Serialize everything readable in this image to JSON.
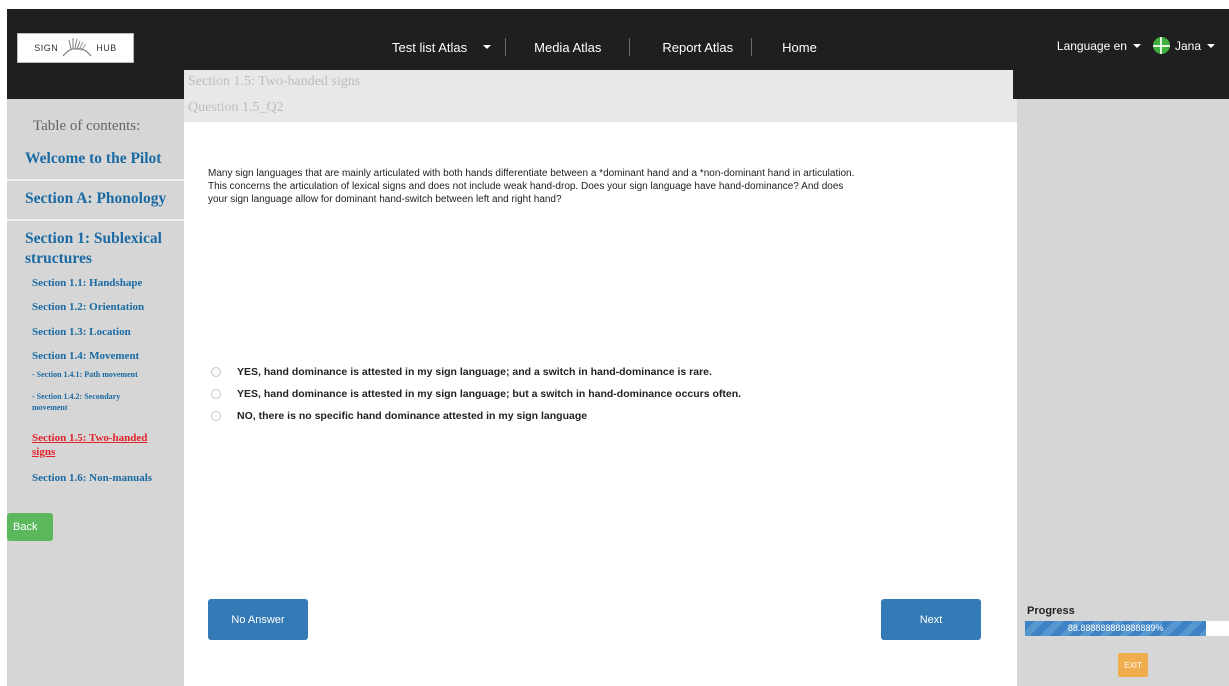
{
  "nav": {
    "logo_text_left": "SIGN",
    "logo_text_right": "HUB",
    "test_list": "Test list Atlas",
    "media_atlas": "Media Atlas",
    "report_atlas": "Report Atlas",
    "home": "Home",
    "language": "Language en",
    "user": "Jana"
  },
  "sidebar": {
    "toc_title": "Table of contents:",
    "welcome": "Welcome to the Pilot",
    "section_a": "Section A: Phonology",
    "section_1_line1": "Section 1: Sublexical",
    "section_1_line2": "structures",
    "s1_1": "Section 1.1: Handshape",
    "s1_2": "Section 1.2: Orientation",
    "s1_3": "Section 1.3: Location",
    "s1_4": "Section 1.4: Movement",
    "s1_4_1": "- Section 1.4.1: Path movement",
    "s1_4_2_line1": "- Section 1.4.2: Secondary",
    "s1_4_2_line2": "movement",
    "s1_5_line1": "Section 1.5: Two-handed",
    "s1_5_line2": "signs",
    "s1_6": "Section 1.6: Non-manuals",
    "back": "Back"
  },
  "content": {
    "section_title": "Section 1.5: Two-handed signs",
    "question_title": "Question 1.5_Q2",
    "question_line1": "Many sign languages that are mainly articulated with both hands differentiate between a *dominant hand and a *non-dominant hand in articulation.",
    "question_line2": "This concerns the articulation of lexical signs and does not include weak hand-drop. Does your sign language have hand-dominance? And does",
    "question_line3": "your sign language allow for dominant hand-switch between left and right hand?",
    "options": [
      "YES, hand dominance is attested in my sign language; and a switch in hand-dominance is rare.",
      "YES, hand dominance is attested in my sign language; but a switch in hand-dominance occurs often.",
      "NO, there is no specific hand dominance attested in my sign language"
    ],
    "no_answer": "No Answer",
    "next": "Next"
  },
  "progress": {
    "label": "Progress",
    "value_text": "88.888888888888889%",
    "value": 0.8889
  },
  "exit": "EXIT",
  "colors": {
    "link_blue": "#1a6aa3",
    "active_red": "#e0232a",
    "button_blue": "#337ab7",
    "back_green": "#5cb85c",
    "exit_orange": "#f0ad4e"
  }
}
